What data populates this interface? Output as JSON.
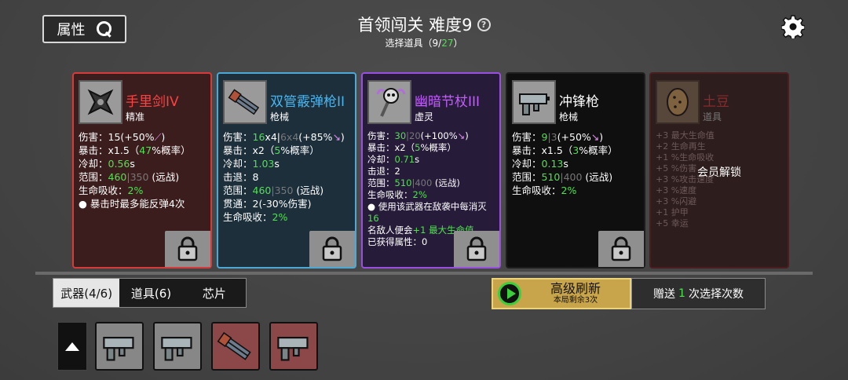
{
  "header": {
    "attr_button": "属性",
    "title": "首领闯关 难度9",
    "help_symbol": "?",
    "subtitle_prefix": "选择道具（",
    "subtitle_current": "9",
    "subtitle_sep": "/",
    "subtitle_total": "27",
    "subtitle_suffix": "）"
  },
  "cards": {
    "c1": {
      "name": "手里剑IV",
      "type": "精准",
      "l1a": "伤害：15(+50%",
      "l1b": ")",
      "l2a": "暴击：x1.5（",
      "l2b": "47",
      "l2c": "%概率）",
      "l3a": "冷却：",
      "l3b": "0.56",
      "l3c": "s",
      "l4a": "范围：",
      "l4b": "460",
      "l4c": "|350",
      "l4d": " (远战)",
      "l5a": "生命吸收：",
      "l5b": "2%",
      "l6": "● 暴击时最多能反弹4次"
    },
    "c2": {
      "name": "双管霰弹枪II",
      "type": "枪械",
      "l1a": "伤害：",
      "l1b": "16",
      "l1c": "x4|",
      "l1d": "6x4",
      "l1e": "(+85%",
      "l2a": "暴击：x2（",
      "l2b": "5",
      "l2c": "%概率）",
      "l3a": "冷却：",
      "l3b": "1.03",
      "l3c": "s",
      "l4": "击退：8",
      "l5a": "范围：",
      "l5b": "460",
      "l5c": "|350",
      "l5d": " (远战)",
      "l6": "贯通：2(-30%伤害)",
      "l7a": "生命吸收：",
      "l7b": "2%"
    },
    "c3": {
      "name": "幽暗节杖III",
      "type": "虚灵",
      "l1a": "伤害：",
      "l1b": "30",
      "l1c": "|20",
      "l1d": "(+100%",
      "l2a": "暴击：x2（",
      "l2b": "5",
      "l2c": "%概率）",
      "l3a": "冷却：",
      "l3b": "0.71",
      "l3c": "s",
      "l4": "击退：2",
      "l5a": "范围：",
      "l5b": "510",
      "l5c": "|400",
      "l5d": " (远战)",
      "l6a": "生命吸收：",
      "l6b": "2%",
      "l7a": "● 使用该武器在敌袭中每消灭",
      "l7b": "16",
      "l8a": "名敌人便会",
      "l8b": "+1 最大生命值",
      "l9": "已获得属性：0"
    },
    "c4": {
      "name": "冲锋枪",
      "type": "枪械",
      "l1a": "伤害：",
      "l1b": "9",
      "l1c": "|3",
      "l1d": "(+50%",
      "l2a": "暴击：x1.5（",
      "l2b": "3",
      "l2c": "%概率）",
      "l3a": "冷却：",
      "l3b": "0.13",
      "l3c": "s",
      "l4a": "范围：",
      "l4b": "510",
      "l4c": "|400",
      "l4d": " (远战)",
      "l5a": "生命吸收：",
      "l5b": "2%"
    },
    "c5": {
      "name": "土豆",
      "type": "道具",
      "lines": [
        "+3 最大生命值",
        "+2 生命再生",
        "+1 %生命吸收",
        "+5 %伤害",
        "+3 %攻击速度",
        "+3 %速度",
        "+3 %闪避",
        "+1 护甲",
        "+5 幸运"
      ],
      "member_unlock": "会员解锁"
    }
  },
  "tabs": [
    "武器(4/6)",
    "道具(6)",
    "芯片"
  ],
  "refresh": {
    "main": "高级刷新",
    "sub": "本局剩余3次"
  },
  "bonus": {
    "prefix": "赠送",
    "count": "1",
    "suffix": "次选择次数"
  },
  "colors": {
    "green": "#4fe24f",
    "red_rarity": "#d63a3a",
    "blue_rarity": "#4aa9d6",
    "purple_rarity": "#9a4fe0"
  }
}
